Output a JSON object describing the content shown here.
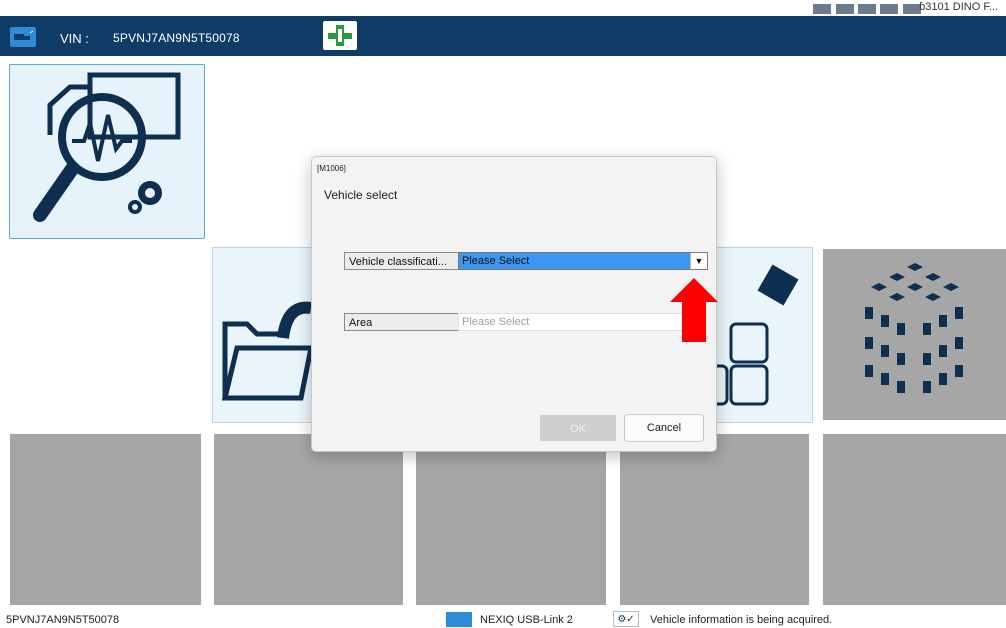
{
  "top_right_text": "ɓ3101 DINO F...",
  "header": {
    "vin_label": "VIN :",
    "vin_value": "5PVNJ7AN9N5T50078"
  },
  "dialog": {
    "code": "[M1006]",
    "title": "Vehicle select",
    "vehicle_classification_label": "Vehicle classificati...",
    "vehicle_classification_value": "Please Select",
    "area_label": "Area",
    "area_placeholder": "Please Select",
    "ok_label": "OK",
    "cancel_label": "Cancel"
  },
  "footer": {
    "vin": "5PVNJ7AN9N5T50078",
    "interface": "NEXIQ USB-Link 2",
    "status": "Vehicle information is being acquired."
  },
  "colors": {
    "header_bg": "#0e3c66",
    "select_highlight": "#3d97f2",
    "arrow_annotation": "#ff0000",
    "tile_gray": "#a6a6a6"
  }
}
